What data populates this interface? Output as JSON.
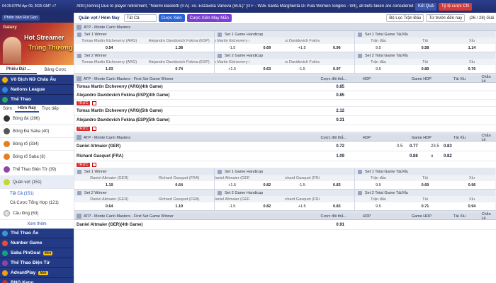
{
  "topbar": {
    "time": "04:25:07PM Apr 09, 2025 GMT +7",
    "ticker": "Attn:[Tennis] Due to player retirement, \"Noemi Basiletti (ITA) -vs- Elizaveta Vaneva (BUL)\" [ITF - W35 Santa Margherita Di Pula Women Singles - 9/4], all bets taken are considered",
    "result_btn": "Kết Quả",
    "odds_type": "Tỷ lệ cược CN"
  },
  "sidebar": {
    "promo_label": "Phiên bản Rút Gọn",
    "banner_brand": "Galaxy",
    "banner_line1": "Hot Streamer",
    "banner_line2": "Trúng Thưởng",
    "tabs": [
      "Phiếu Đặt ...",
      "Bảng Cược"
    ],
    "categories": [
      {
        "label": "Vô Địch Nữ Châu Âu",
        "color": "#f0b400"
      },
      {
        "label": "Nations League",
        "color": "#2e86de"
      },
      {
        "label": "Thể Thao",
        "color": "#27ae60"
      }
    ],
    "subtabs": [
      "Sớm",
      "Hôm Nay",
      "Trực tiếp"
    ],
    "sports": [
      {
        "label": "Bóng đá (286)",
        "color": "#333"
      },
      {
        "label": "Bóng Đá Saba (40)",
        "color": "#555"
      },
      {
        "label": "Bóng rổ (334)",
        "color": "#e67e22"
      },
      {
        "label": "Bóng rổ Saba (8)",
        "color": "#e67e22"
      },
      {
        "label": "Thể Thao Điện Tử (39)",
        "color": "#8e44ad"
      },
      {
        "label": "Quần vợt (151)",
        "color": "#c5d82b"
      }
    ],
    "tennis_sub": [
      "Tất Cả (151)",
      "Cá Cược Tổng Hợp (121)"
    ],
    "badminton": "Cầu lông (63)",
    "more": "Xem thêm",
    "bottom_cats": [
      {
        "label": "Thể Thao Ảo",
        "color": "#3498db"
      },
      {
        "label": "Number Game",
        "color": "#e74c3c"
      },
      {
        "label": "Saba PinGoal",
        "color": "#16a085"
      },
      {
        "label": "Thể Thao Điện Tử",
        "color": "#8e44ad"
      },
      {
        "label": "AdvantPlay",
        "color": "#f39c12"
      },
      {
        "label": "RNG Keno",
        "color": "#c0392b"
      }
    ],
    "new_badge": "Mới"
  },
  "filters": {
    "sport": "Quần vợt / Hôm Nay",
    "all": "Tất Cả",
    "bet_btn": "Cược Xiên",
    "parlay_btn": "Cược Xiên May Mắn",
    "league_filter": "Bộ Lọc Trận Đấu",
    "sort": "Từ trước đến nay",
    "count": "(26 / 28) Giải"
  },
  "headers": {
    "bet_col": "Cược đôi thắ...",
    "hdp": "HDP",
    "game_hdp": "Game HDP",
    "tx": "Tài Xỉu",
    "parity": "Chẵn Lẻ"
  },
  "league1": "ATP - Monte Carlo Masters",
  "panels_a": [
    {
      "title": "Set 1 Winner",
      "cols": [
        "Tomas Martin Etcheverry (ARG)",
        "Alejandro Davidovich Fokina (ESP)"
      ],
      "vals": [
        "0.54",
        "1.38"
      ]
    },
    {
      "title": "Set 1 Game Handicap",
      "cols": [
        "Tomas Martin Etcheverry (ARG)",
        "",
        "Alejandro Davidovich Fokina (ESP)",
        ""
      ],
      "vals": [
        "-1.5",
        "0.69",
        "+1.5",
        "0.96"
      ]
    },
    {
      "title": "Set 1 Total Game Tài/Xỉu",
      "cols": [
        "Trận đấu",
        "Tài",
        "Xỉu"
      ],
      "vals": [
        "9.5",
        "0.58",
        "1.14"
      ]
    }
  ],
  "panels_b": [
    {
      "title": "Set 2 Winner",
      "cols": [
        "Tomas Martin Etcheverry (ARG)",
        "Alejandro Davidovich Fokina (ESP)"
      ],
      "vals": [
        "1.03",
        "0.74"
      ]
    },
    {
      "title": "Set 2 Game Handicap",
      "cols": [
        "Tomas Martin Etcheverry (ARG)",
        "",
        "Alejandro Davidovich Fokina (ESP)",
        ""
      ],
      "vals": [
        "+1.5",
        "0.63",
        "-1.5",
        "0.97"
      ]
    },
    {
      "title": "Set 2 Total Game Tài/Xỉu",
      "cols": [
        "Trận đấu",
        "Tài",
        "Xỉu"
      ],
      "vals": [
        "9.5",
        "0.89",
        "0.76"
      ]
    }
  ],
  "league2": "ATP - Monte Carlo Masters - First Set Game Winner",
  "game4": [
    {
      "team": "Tomas Martin Etcheverry (ARG)(4th Game)",
      "odd": "0.85"
    },
    {
      "team": "Alejandro Davidovich Fokina (ESP)(4th Game)",
      "odd": "0.85"
    }
  ],
  "game5": [
    {
      "team": "Tomas Martin Etcheverry (ARG)(5th Game)",
      "odd": "2.12"
    },
    {
      "team": "Alejandro Davidovich Fokina (ESP)(5th Game)",
      "odd": "0.31"
    }
  ],
  "live_label": "TRỰC",
  "league3": "ATP - Monte Carlo Masters",
  "match2": [
    {
      "team": "Daniel Altmaier (GER)",
      "odd": "0.72",
      "hdp": "",
      "hdp_odd": "",
      "line": "0.5",
      "line_odd": "0.77",
      "tx": "23.5",
      "tx_odd": "0.83"
    },
    {
      "team": "Richard Gasquet (FRA)",
      "odd": "1.09",
      "hdp": "",
      "hdp_odd": "",
      "line": "",
      "line_odd": "0.88",
      "tx": "u",
      "tx_odd": "0.82"
    }
  ],
  "panels_c": [
    {
      "title": "Set 1 Winner",
      "cols": [
        "Daniel Altmaier (GER)",
        "Richard Gasquet (FRA)"
      ],
      "vals": [
        "1.19",
        "0.64"
      ]
    },
    {
      "title": "Set 1 Game Handicap",
      "cols": [
        "Daniel Altmaier (GER)",
        "",
        "Richard Gasquet (FRA)",
        ""
      ],
      "vals": [
        "+1.5",
        "0.82",
        "-1.5",
        "0.83"
      ]
    },
    {
      "title": "Set 1 Total Game Tài/Xỉu",
      "cols": [
        "Trận đấu",
        "Tài",
        "Xỉu"
      ],
      "vals": [
        "9.5",
        "0.69",
        "0.96"
      ]
    }
  ],
  "panels_d": [
    {
      "title": "Set 2 Winner",
      "cols": [
        "Daniel Altmaier (GER)",
        "Richard Gasquet (FRA)"
      ],
      "vals": [
        "0.64",
        "1.19"
      ]
    },
    {
      "title": "Set 2 Game Handicap",
      "cols": [
        "Daniel Altmaier (GER)",
        "",
        "Richard Gasquet (FRA)",
        ""
      ],
      "vals": [
        "-1.5",
        "0.82",
        "+1.5",
        "0.83"
      ]
    },
    {
      "title": "Set 2 Total Game Tài/Xỉu",
      "cols": [
        "Trận đấu",
        "Tài",
        "Xỉu"
      ],
      "vals": [
        "9.5",
        "0.71",
        "0.94"
      ]
    }
  ],
  "league4": "ATP - Monte Carlo Masters - First Set Game Winner",
  "game4b": {
    "team": "Daniel Altmaier (GER)(4th Game)",
    "odd": "0.91"
  }
}
